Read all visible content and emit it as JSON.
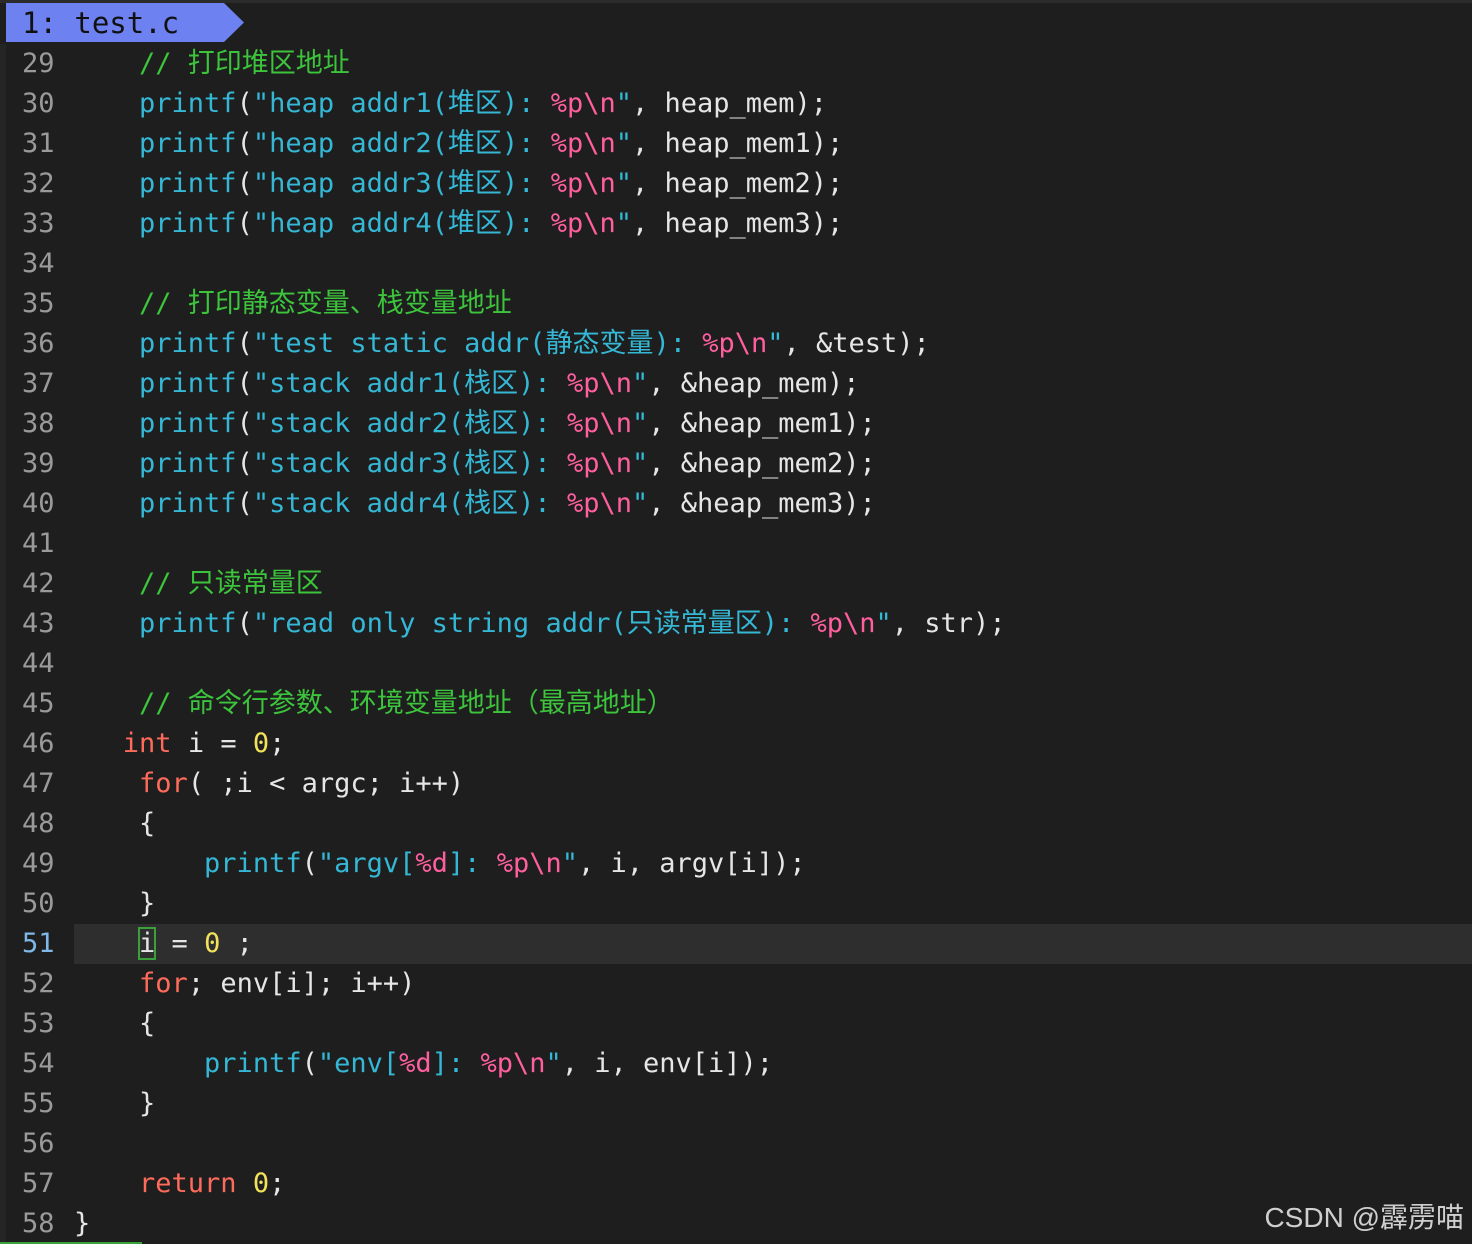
{
  "tab": {
    "label": "1: test.c"
  },
  "colors": {
    "background": "#1e1e1e",
    "tab_bg": "#6d82f0",
    "comment": "#3cc43c",
    "function": "#35b8d6",
    "format": "#ff5f9e",
    "keyword": "#ff6b5b",
    "number": "#f2e15a",
    "current_line_number": "#7fb8e8"
  },
  "current_line": 51,
  "lines": [
    {
      "n": "29",
      "indent": "    ",
      "tokens": [
        {
          "t": "comment",
          "v": "// 打印堆区地址"
        }
      ]
    },
    {
      "n": "30",
      "indent": "    ",
      "tokens": [
        {
          "t": "func",
          "v": "printf"
        },
        {
          "t": "plain",
          "v": "("
        },
        {
          "t": "str",
          "v": "\"heap addr1(堆区): "
        },
        {
          "t": "fmt",
          "v": "%p\\n"
        },
        {
          "t": "str",
          "v": "\""
        },
        {
          "t": "plain",
          "v": ", heap_mem);"
        }
      ]
    },
    {
      "n": "31",
      "indent": "    ",
      "tokens": [
        {
          "t": "func",
          "v": "printf"
        },
        {
          "t": "plain",
          "v": "("
        },
        {
          "t": "str",
          "v": "\"heap addr2(堆区): "
        },
        {
          "t": "fmt",
          "v": "%p\\n"
        },
        {
          "t": "str",
          "v": "\""
        },
        {
          "t": "plain",
          "v": ", heap_mem1);"
        }
      ]
    },
    {
      "n": "32",
      "indent": "    ",
      "tokens": [
        {
          "t": "func",
          "v": "printf"
        },
        {
          "t": "plain",
          "v": "("
        },
        {
          "t": "str",
          "v": "\"heap addr3(堆区): "
        },
        {
          "t": "fmt",
          "v": "%p\\n"
        },
        {
          "t": "str",
          "v": "\""
        },
        {
          "t": "plain",
          "v": ", heap_mem2);"
        }
      ]
    },
    {
      "n": "33",
      "indent": "    ",
      "tokens": [
        {
          "t": "func",
          "v": "printf"
        },
        {
          "t": "plain",
          "v": "("
        },
        {
          "t": "str",
          "v": "\"heap addr4(堆区): "
        },
        {
          "t": "fmt",
          "v": "%p\\n"
        },
        {
          "t": "str",
          "v": "\""
        },
        {
          "t": "plain",
          "v": ", heap_mem3);"
        }
      ]
    },
    {
      "n": "34",
      "indent": "",
      "tokens": []
    },
    {
      "n": "35",
      "indent": "    ",
      "tokens": [
        {
          "t": "comment",
          "v": "// 打印静态变量、栈变量地址"
        }
      ]
    },
    {
      "n": "36",
      "indent": "    ",
      "tokens": [
        {
          "t": "func",
          "v": "printf"
        },
        {
          "t": "plain",
          "v": "("
        },
        {
          "t": "str",
          "v": "\"test static addr(静态变量): "
        },
        {
          "t": "fmt",
          "v": "%p\\n"
        },
        {
          "t": "str",
          "v": "\""
        },
        {
          "t": "plain",
          "v": ", &test);"
        }
      ]
    },
    {
      "n": "37",
      "indent": "    ",
      "tokens": [
        {
          "t": "func",
          "v": "printf"
        },
        {
          "t": "plain",
          "v": "("
        },
        {
          "t": "str",
          "v": "\"stack addr1(栈区): "
        },
        {
          "t": "fmt",
          "v": "%p\\n"
        },
        {
          "t": "str",
          "v": "\""
        },
        {
          "t": "plain",
          "v": ", &heap_mem);"
        }
      ]
    },
    {
      "n": "38",
      "indent": "    ",
      "tokens": [
        {
          "t": "func",
          "v": "printf"
        },
        {
          "t": "plain",
          "v": "("
        },
        {
          "t": "str",
          "v": "\"stack addr2(栈区): "
        },
        {
          "t": "fmt",
          "v": "%p\\n"
        },
        {
          "t": "str",
          "v": "\""
        },
        {
          "t": "plain",
          "v": ", &heap_mem1);"
        }
      ]
    },
    {
      "n": "39",
      "indent": "    ",
      "tokens": [
        {
          "t": "func",
          "v": "printf"
        },
        {
          "t": "plain",
          "v": "("
        },
        {
          "t": "str",
          "v": "\"stack addr3(栈区): "
        },
        {
          "t": "fmt",
          "v": "%p\\n"
        },
        {
          "t": "str",
          "v": "\""
        },
        {
          "t": "plain",
          "v": ", &heap_mem2);"
        }
      ]
    },
    {
      "n": "40",
      "indent": "    ",
      "tokens": [
        {
          "t": "func",
          "v": "printf"
        },
        {
          "t": "plain",
          "v": "("
        },
        {
          "t": "str",
          "v": "\"stack addr4(栈区): "
        },
        {
          "t": "fmt",
          "v": "%p\\n"
        },
        {
          "t": "str",
          "v": "\""
        },
        {
          "t": "plain",
          "v": ", &heap_mem3);"
        }
      ]
    },
    {
      "n": "41",
      "indent": "",
      "tokens": []
    },
    {
      "n": "42",
      "indent": "    ",
      "tokens": [
        {
          "t": "comment",
          "v": "// 只读常量区"
        }
      ]
    },
    {
      "n": "43",
      "indent": "    ",
      "tokens": [
        {
          "t": "func",
          "v": "printf"
        },
        {
          "t": "plain",
          "v": "("
        },
        {
          "t": "str",
          "v": "\"read only string addr(只读常量区): "
        },
        {
          "t": "fmt",
          "v": "%p\\n"
        },
        {
          "t": "str",
          "v": "\""
        },
        {
          "t": "plain",
          "v": ", str);"
        }
      ]
    },
    {
      "n": "44",
      "indent": "",
      "tokens": []
    },
    {
      "n": "45",
      "indent": "    ",
      "tokens": [
        {
          "t": "comment",
          "v": "// 命令行参数、环境变量地址（最高地址）"
        }
      ]
    },
    {
      "n": "46",
      "indent": "   ",
      "tokens": [
        {
          "t": "kw",
          "v": "int"
        },
        {
          "t": "plain",
          "v": " i = "
        },
        {
          "t": "num",
          "v": "0"
        },
        {
          "t": "plain",
          "v": ";"
        }
      ]
    },
    {
      "n": "47",
      "indent": "    ",
      "tokens": [
        {
          "t": "kw",
          "v": "for"
        },
        {
          "t": "plain",
          "v": "( ;i < argc; i++)"
        }
      ]
    },
    {
      "n": "48",
      "indent": "    ",
      "tokens": [
        {
          "t": "plain",
          "v": "{"
        }
      ]
    },
    {
      "n": "49",
      "indent": "        ",
      "tokens": [
        {
          "t": "func",
          "v": "printf"
        },
        {
          "t": "plain",
          "v": "("
        },
        {
          "t": "str",
          "v": "\"argv["
        },
        {
          "t": "fmt",
          "v": "%d"
        },
        {
          "t": "str",
          "v": "]: "
        },
        {
          "t": "fmt",
          "v": "%p\\n"
        },
        {
          "t": "str",
          "v": "\""
        },
        {
          "t": "plain",
          "v": ", i, argv[i]);"
        }
      ]
    },
    {
      "n": "50",
      "indent": "    ",
      "tokens": [
        {
          "t": "plain",
          "v": "}"
        }
      ]
    },
    {
      "n": "51",
      "indent": "    ",
      "tokens": [
        {
          "t": "cursor",
          "v": "i"
        },
        {
          "t": "plain",
          "v": " = "
        },
        {
          "t": "num",
          "v": "0"
        },
        {
          "t": "plain",
          "v": " ;"
        }
      ]
    },
    {
      "n": "52",
      "indent": "    ",
      "tokens": [
        {
          "t": "kw",
          "v": "for"
        },
        {
          "t": "plain",
          "v": "; env[i]; i++)"
        }
      ]
    },
    {
      "n": "53",
      "indent": "    ",
      "tokens": [
        {
          "t": "plain",
          "v": "{"
        }
      ]
    },
    {
      "n": "54",
      "indent": "        ",
      "tokens": [
        {
          "t": "func",
          "v": "printf"
        },
        {
          "t": "plain",
          "v": "("
        },
        {
          "t": "str",
          "v": "\"env["
        },
        {
          "t": "fmt",
          "v": "%d"
        },
        {
          "t": "str",
          "v": "]: "
        },
        {
          "t": "fmt",
          "v": "%p\\n"
        },
        {
          "t": "str",
          "v": "\""
        },
        {
          "t": "plain",
          "v": ", i, env[i]);"
        }
      ]
    },
    {
      "n": "55",
      "indent": "    ",
      "tokens": [
        {
          "t": "plain",
          "v": "}"
        }
      ]
    },
    {
      "n": "56",
      "indent": "",
      "tokens": []
    },
    {
      "n": "57",
      "indent": "    ",
      "tokens": [
        {
          "t": "kw",
          "v": "return"
        },
        {
          "t": "plain",
          "v": " "
        },
        {
          "t": "num",
          "v": "0"
        },
        {
          "t": "plain",
          "v": ";"
        }
      ]
    },
    {
      "n": "58",
      "indent": "",
      "tokens": [
        {
          "t": "plain",
          "v": "}"
        }
      ]
    }
  ],
  "watermark": "CSDN @霹雳喵"
}
